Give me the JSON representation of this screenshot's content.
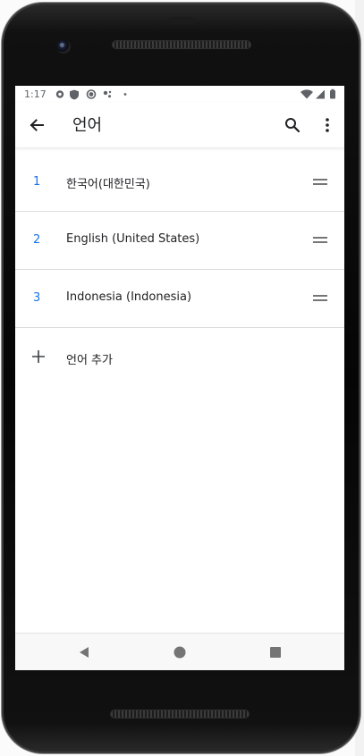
{
  "status_bar": {
    "time": "1:17",
    "left_icons": [
      "gear-icon",
      "shield-icon",
      "sync-icon",
      "assistant-dots-icon",
      "dot-icon"
    ],
    "right_icons": [
      "wifi-icon",
      "signal-icon",
      "battery-icon"
    ]
  },
  "app_bar": {
    "title": "언어"
  },
  "languages": [
    {
      "number": "1",
      "label": "한국어(대한민국)"
    },
    {
      "number": "2",
      "label": "English (United States)"
    },
    {
      "number": "3",
      "label": "Indonesia (Indonesia)"
    }
  ],
  "add_language": {
    "label": "언어 추가"
  },
  "colors": {
    "accent": "#1a73e8",
    "text": "#202124",
    "icon": "#5f6368"
  }
}
